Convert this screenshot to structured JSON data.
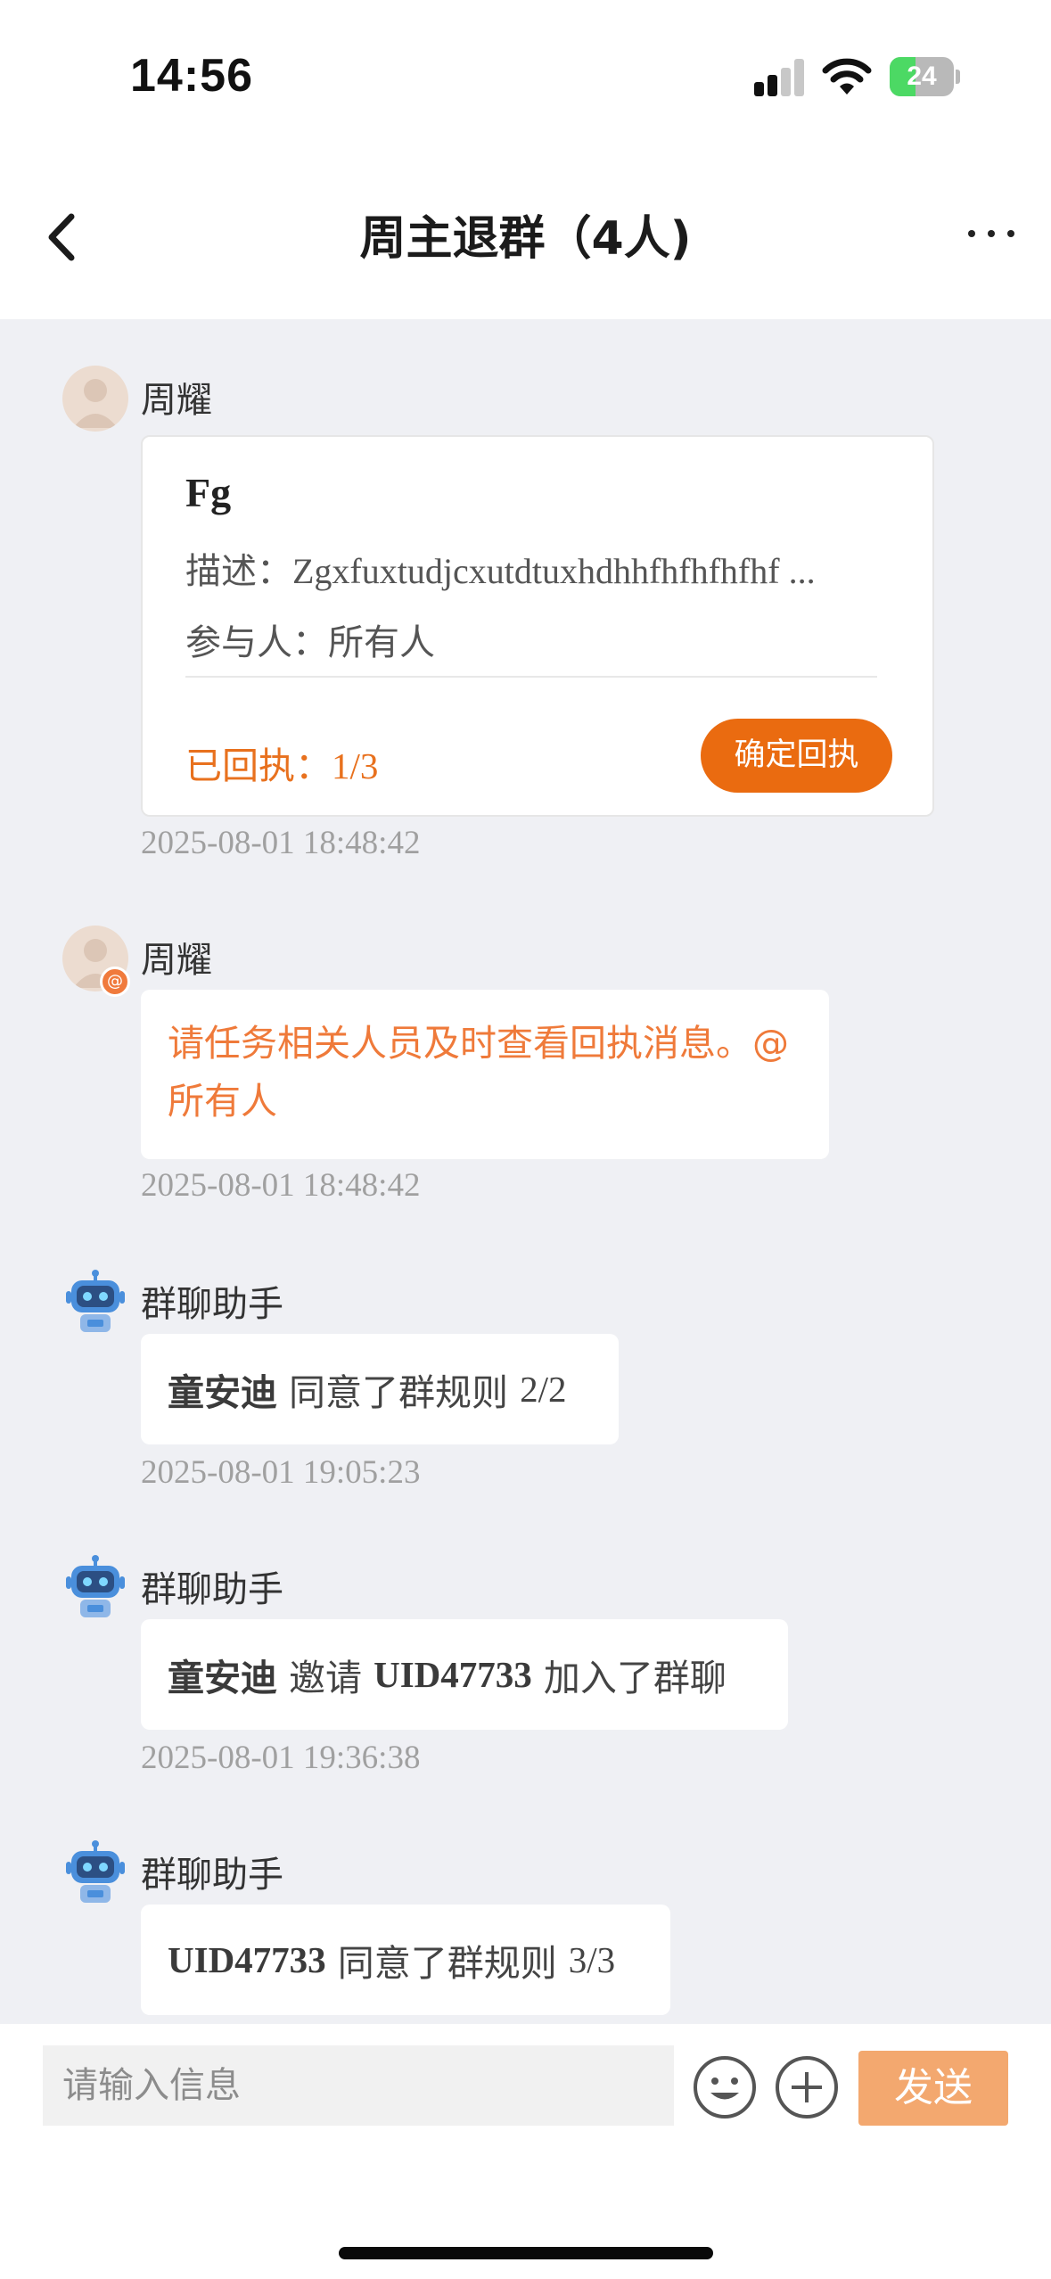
{
  "status_bar": {
    "time": "14:56",
    "battery_level": "24",
    "signal_bars_active": 2,
    "signal_bars_total": 4,
    "icons": [
      "signal-icon",
      "wifi-icon",
      "battery-icon"
    ]
  },
  "header": {
    "title": "周主退群（4人)",
    "back_icon": "chevron-left-icon",
    "more_icon": "more-horizontal-icon"
  },
  "messages": [
    {
      "sender": "周耀",
      "avatar": "user-avatar",
      "card": {
        "title": "Fg",
        "desc_label": "描述：",
        "desc_value": "Zgxfuxtudjcxutdtuxhdhhfhfhfhfhf ...",
        "participants_label": "参与人：",
        "participants_value": "所有人",
        "receipt_label": "已回执：",
        "receipt_value": "1/3",
        "confirm_label": "确定回执"
      },
      "time": "2025-08-01 18:48:42"
    },
    {
      "sender": "周耀",
      "avatar": "user-avatar",
      "badge": "@",
      "text": "请任务相关人员及时查看回执消息。@所有人",
      "time": "2025-08-01 18:48:42"
    },
    {
      "sender": "群聊助手",
      "avatar": "robot-icon",
      "name_bold": "童安迪",
      "text": "同意了群规则",
      "count": "2/2",
      "time": "2025-08-01 19:05:23"
    },
    {
      "sender": "群聊助手",
      "avatar": "robot-icon",
      "name_bold": "童安迪",
      "text_mid": "邀请",
      "uid_bold": "UID47733",
      "text_end": "加入了群聊",
      "time": "2025-08-01 19:36:38"
    },
    {
      "sender": "群聊助手",
      "avatar": "robot-icon",
      "uid_bold": "UID47733",
      "text": "同意了群规则",
      "count": "3/3"
    }
  ],
  "input_bar": {
    "placeholder": "请输入信息",
    "emoji_icon": "emoji-smile-icon",
    "plus_icon": "plus-circle-icon",
    "send_label": "发送"
  },
  "colors": {
    "accent": "#ea6b10",
    "accent_light": "#f3a86f",
    "chat_bg": "#eff0f4",
    "receipt_text": "#e8711e",
    "mention_text": "#ef7a3a"
  }
}
